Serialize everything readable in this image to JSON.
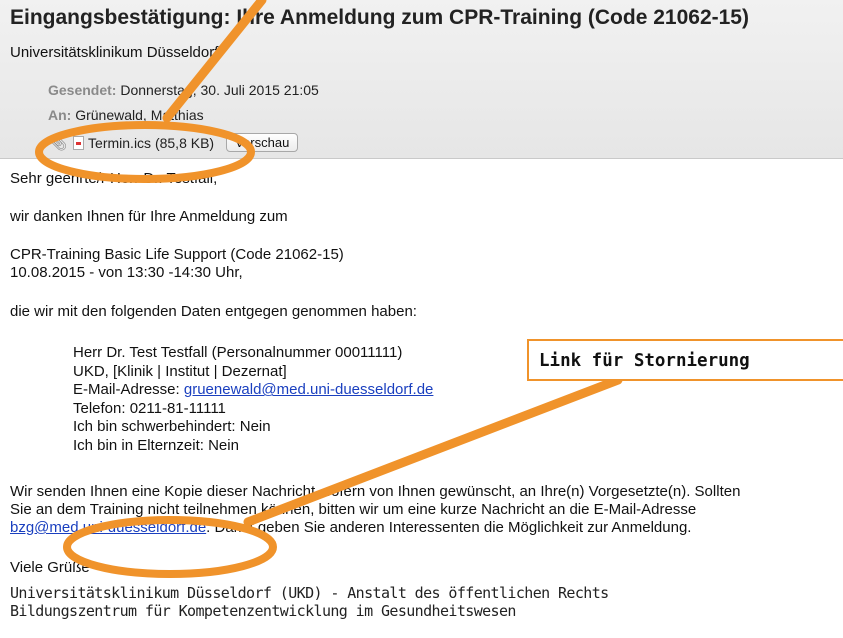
{
  "email": {
    "subject": "Eingangsbestätigung: Ihre Anmeldung zum CPR-Training (Code 21062-15)",
    "sender": "Universitätsklinikum Düsseldorf",
    "sent_label": "Gesendet:",
    "sent_value": "Donnerstag, 30. Juli 2015 21:05",
    "to_label": "An:",
    "to_value": "Grünewald, Matthias",
    "attachment": {
      "filename": "Termin.ics (85,8 KB)",
      "preview_label": "Vorschau"
    }
  },
  "body": {
    "greeting": "Sehr geehrte/r Herr Dr. Testfall,",
    "thanks": "wir danken Ihnen für Ihre Anmeldung zum",
    "course_line1": "CPR-Training Basic Life Support (Code 21062-15)",
    "course_line2": "10.08.2015 - von 13:30 -14:30 Uhr,",
    "data_intro": "die wir mit den folgenden Daten entgegen genommen haben:",
    "details": {
      "name": "Herr Dr. Test Testfall (Personalnummer 00011111)",
      "unit": "UKD, [Klinik | Institut | Dezernat]",
      "email_label": "E-Mail-Adresse: ",
      "email": "gruenewald@med.uni-duesseldorf.de",
      "phone": "Telefon: 0211-81-11111",
      "disabled": "Ich bin schwerbehindert: Nein",
      "parental": "Ich bin in Elternzeit: Nein"
    },
    "para_line1": "Wir senden Ihnen eine Kopie dieser Nachricht, sofern von Ihnen gewünscht, an Ihre(n) Vorgesetzte(n). Sollten",
    "para_line2": "Sie an dem Training nicht teilnehmen können, bitten wir um eine kurze Nachricht an die E-Mail-Adresse",
    "para_link": "bzg@med.uni-duesseldorf.de",
    "para_line3_rest": ". Damit geben Sie anderen Interessenten die Möglichkeit zur Anmeldung.",
    "closing": "Viele Grüße",
    "signature_line1": "Universitätsklinikum Düsseldorf (UKD) - Anstalt des öffentlichen Rechts",
    "signature_line2": "Bildungszentrum für Kompetenzentwicklung im Gesundheitswesen"
  },
  "annotation": {
    "callout_text": "Link für Stornierung",
    "color": "#f0932b"
  },
  "colors": {
    "link": "#1a3fbf",
    "header_bg": "#ececec",
    "label_gray": "#8a8a8a"
  }
}
